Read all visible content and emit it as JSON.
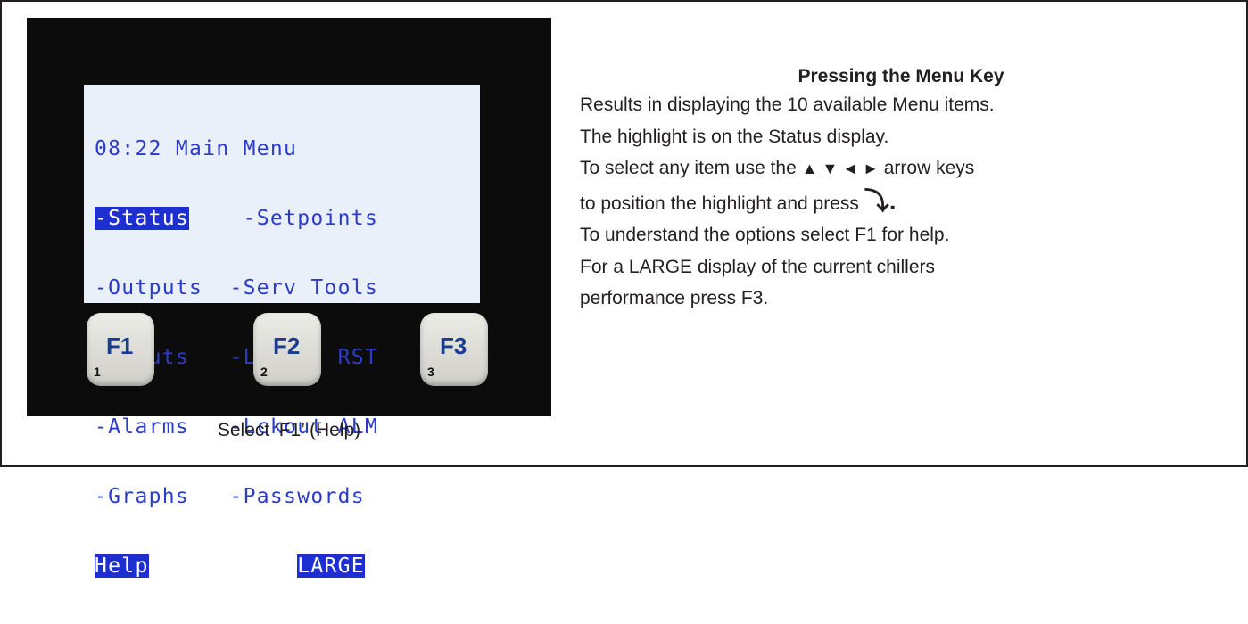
{
  "device": {
    "lcd": {
      "header": "08:22 Main Menu",
      "menu_rows": [
        {
          "left": "-Status",
          "right": "-Setpoints",
          "left_highlighted": true
        },
        {
          "left": "-Outputs",
          "right": "-Serv Tools",
          "left_highlighted": false
        },
        {
          "left": "-Inputs",
          "right": "-Lckout RST",
          "left_highlighted": false
        },
        {
          "left": "-Alarms",
          "right": "-Lckout ALM",
          "left_highlighted": false
        },
        {
          "left": "-Graphs",
          "right": "-Passwords",
          "left_highlighted": false
        }
      ],
      "softkey_left": "Help",
      "softkey_right": "LARGE"
    },
    "keys": [
      {
        "label": "F1",
        "number": "1"
      },
      {
        "label": "F2",
        "number": "2"
      },
      {
        "label": "F3",
        "number": "3"
      }
    ]
  },
  "caption": "Select ‘F1’ (Help)",
  "instructions": {
    "title": "Pressing the Menu Key",
    "line1": "Results in displaying the 10 available Menu items.",
    "line2": "The highlight is on the Status display.",
    "line3_prefix": "To select any item use the",
    "line3_arrows": "▲ ▼ ◄ ►",
    "line3_suffix": "arrow keys",
    "line4_prefix": "to position the highlight and press",
    "line4_symbol": "⤵.",
    "line5": "To understand the options select F1 for help.",
    "line6": "For a LARGE display of the current chillers",
    "line7": "performance press F3."
  }
}
